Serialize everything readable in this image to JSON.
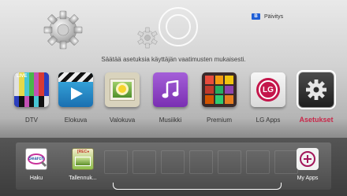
{
  "header": {
    "update_key": "B",
    "update_label": "Päivitys",
    "hint": "Säätää asetuksia käyttäjän vaatimusten mukaisesti."
  },
  "apps": [
    {
      "label": "DTV",
      "icon": "tv-test-pattern-icon"
    },
    {
      "label": "Elokuva",
      "icon": "movie-clapper-icon"
    },
    {
      "label": "Valokuva",
      "icon": "photo-flower-icon"
    },
    {
      "label": "Musiikki",
      "icon": "music-note-icon"
    },
    {
      "label": "Premium",
      "icon": "premium-grid-icon"
    },
    {
      "label": "LG Apps",
      "icon": "lg-logo-icon"
    },
    {
      "label": "Asetukset",
      "icon": "settings-gear-icon",
      "selected": true
    }
  ],
  "dock": {
    "items": [
      {
        "label": "Haku",
        "icon": "search-icon",
        "icon_text": "Search"
      },
      {
        "label": "Tallennuk...",
        "icon": "recordings-icon",
        "icon_text": "[REC●"
      },
      {
        "label": "My Apps",
        "icon": "add-plus-icon"
      }
    ]
  },
  "colors": {
    "accent_selected": "#c8284a",
    "update_key_blue": "#1f5fd6",
    "musiikki_purple": "#8b3fc2",
    "lg_red": "#c4164b"
  }
}
